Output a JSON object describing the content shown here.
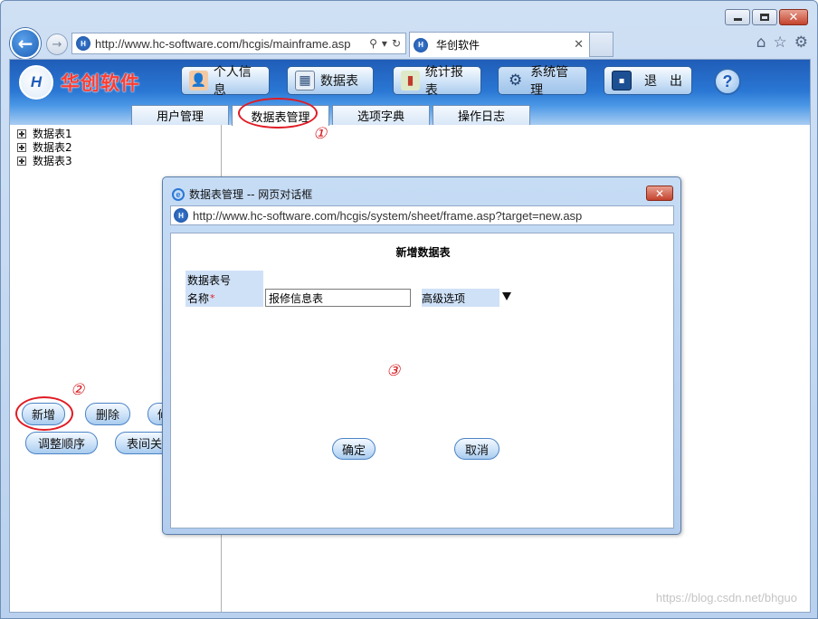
{
  "browser": {
    "address_url": "http://www.hc-software.com/hcgis/mainframe.asp",
    "tab_title": "华创软件"
  },
  "app": {
    "logo_text": "华创软件",
    "logo_mark": "H",
    "menu": [
      {
        "label": "个人信息"
      },
      {
        "label": "数据表"
      },
      {
        "label": "统计报表"
      },
      {
        "label": "系统管理"
      },
      {
        "label": "退　出"
      }
    ],
    "help": "?",
    "subtabs": [
      {
        "label": "用户管理"
      },
      {
        "label": "数据表管理"
      },
      {
        "label": "选项字典"
      },
      {
        "label": "操作日志"
      }
    ]
  },
  "tree": {
    "items": [
      {
        "label": "数据表1"
      },
      {
        "label": "数据表2"
      },
      {
        "label": "数据表3"
      }
    ]
  },
  "left_buttons": {
    "add": "新增",
    "delete": "删除",
    "third_partial": "修",
    "reorder": "调整顺序",
    "relation": "表间关"
  },
  "annotations": {
    "one": "①",
    "two": "②",
    "three": "③"
  },
  "dialog": {
    "title": "数据表管理 -- 网页对话框",
    "url": "http://www.hc-software.com/hcgis/system/sheet/frame.asp?target=new.asp",
    "form_title": "新增数据表",
    "field_id_label": "数据表号",
    "field_name_label": "名称",
    "required_mark": "*",
    "field_name_value": "报修信息表",
    "advanced_label": "高级选项",
    "ok": "确定",
    "cancel": "取消"
  },
  "watermark": "https://blog.csdn.net/bhguo",
  "colors": {
    "annotation_red": "#e01b24",
    "header_blue": "#2a77d4",
    "logo_red": "#ff3b2f"
  }
}
